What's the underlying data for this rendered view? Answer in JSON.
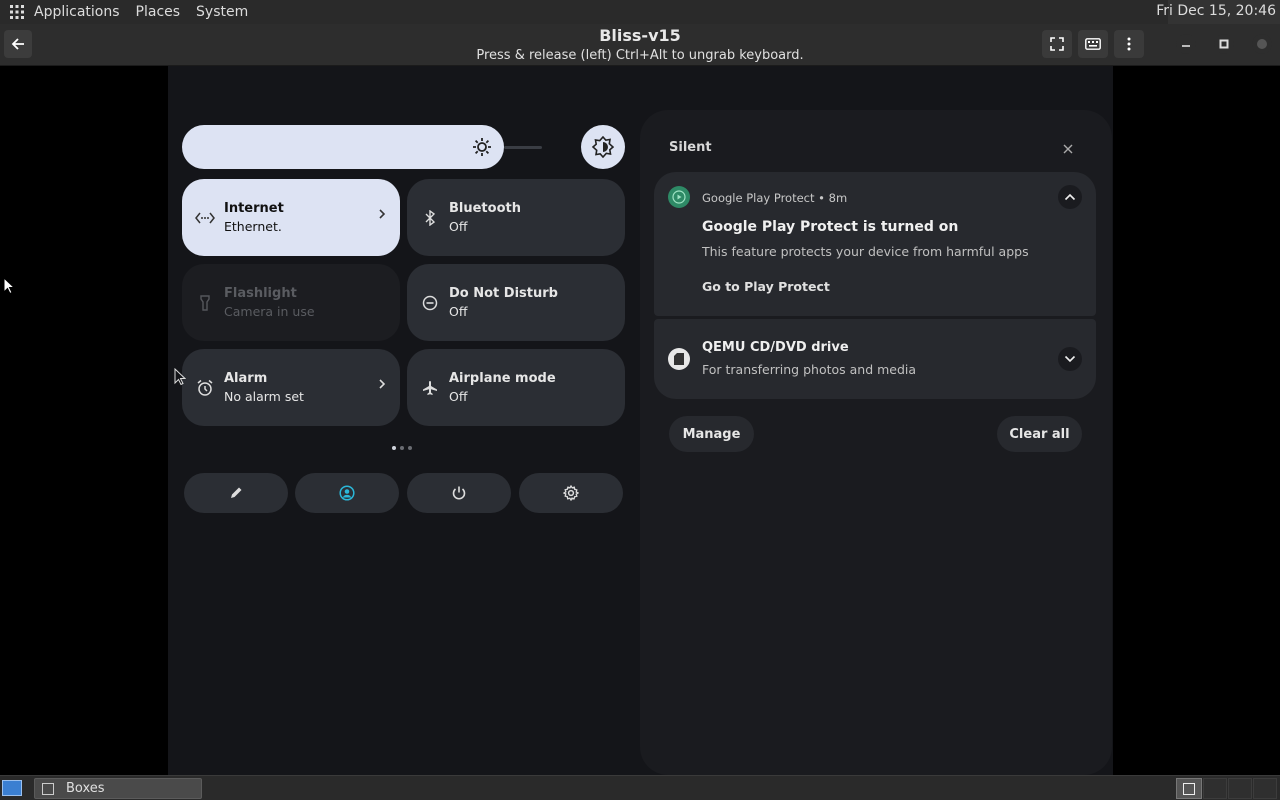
{
  "top_panel": {
    "menus": [
      "Applications",
      "Places",
      "System"
    ],
    "clock": "Fri Dec 15, 20:46"
  },
  "headerbar": {
    "title": "Bliss-v15",
    "subtitle": "Press & release (left) Ctrl+Alt to ungrab keyboard."
  },
  "quick_settings": {
    "tiles": [
      {
        "title": "Internet",
        "subtitle": "Ethernet.",
        "state": "on",
        "icon": "ethernet-icon"
      },
      {
        "title": "Bluetooth",
        "subtitle": "Off",
        "state": "off",
        "icon": "bluetooth-icon"
      },
      {
        "title": "Flashlight",
        "subtitle": "Camera in use",
        "state": "unavailable",
        "icon": "flashlight-icon"
      },
      {
        "title": "Do Not Disturb",
        "subtitle": "Off",
        "state": "off",
        "icon": "do-not-disturb-icon"
      },
      {
        "title": "Alarm",
        "subtitle": "No alarm set",
        "state": "off",
        "icon": "alarm-icon"
      },
      {
        "title": "Airplane mode",
        "subtitle": "Off",
        "state": "off",
        "icon": "airplane-icon"
      }
    ],
    "bottom_buttons": [
      "edit-icon",
      "user-icon",
      "power-icon",
      "settings-icon"
    ],
    "accent": "#2bb7d8"
  },
  "notifications": {
    "section_title": "Silent",
    "items": [
      {
        "app": "Google Play Protect",
        "time": "8m",
        "title": "Google Play Protect is turned on",
        "text": "This feature protects your device from harmful apps",
        "action": "Go to Play Protect"
      },
      {
        "title": "QEMU CD/DVD drive",
        "text": "For transferring photos and media"
      }
    ],
    "manage_label": "Manage",
    "clear_all_label": "Clear all"
  },
  "taskbar": {
    "task_label": "Boxes"
  }
}
